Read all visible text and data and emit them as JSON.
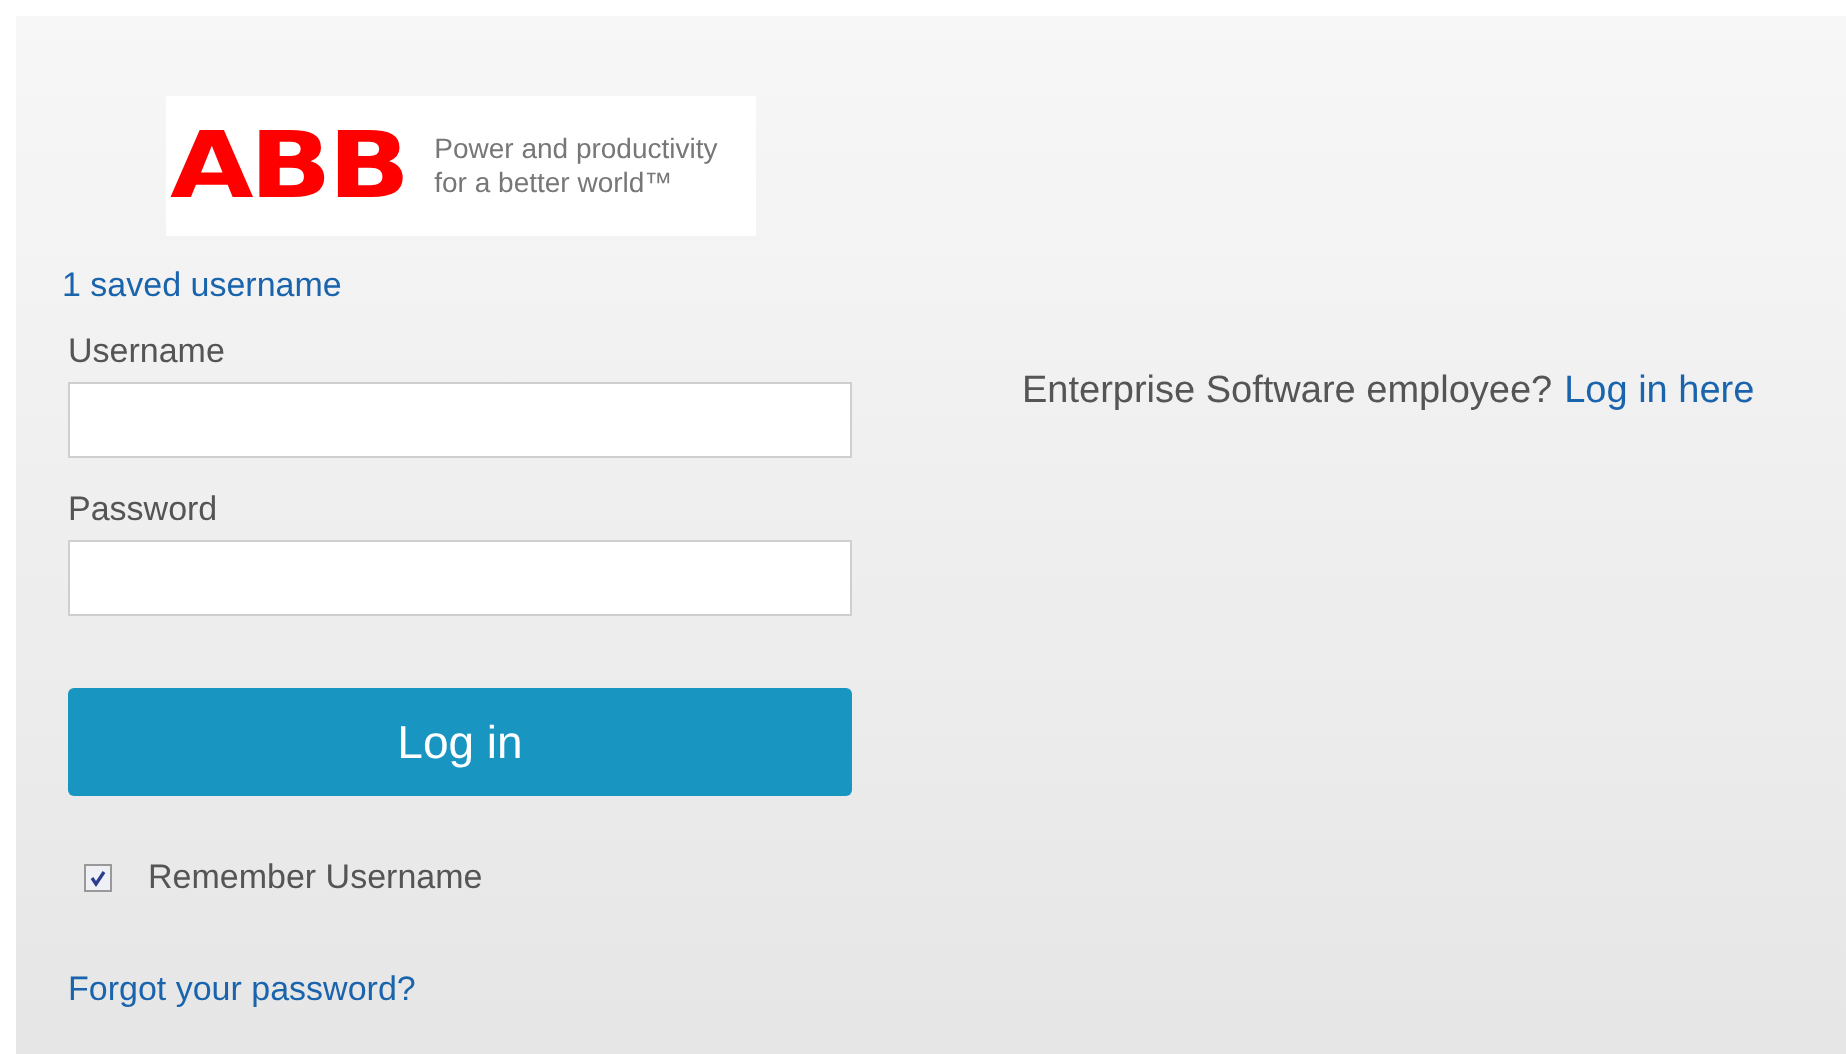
{
  "logo": {
    "mark": "ABB",
    "tagline_lines": [
      "Power and productivity",
      "for a better world™"
    ]
  },
  "saved_usernames_link": "1 saved username",
  "fields": [
    {
      "label": "Username"
    },
    {
      "label": "Password"
    }
  ],
  "login_button": "Log in",
  "remember": {
    "label": "Remember Username",
    "checked": true
  },
  "forgot_link": "Forgot your password?",
  "employee": {
    "text": "Enterprise Software employee?",
    "link": "Log in here"
  }
}
